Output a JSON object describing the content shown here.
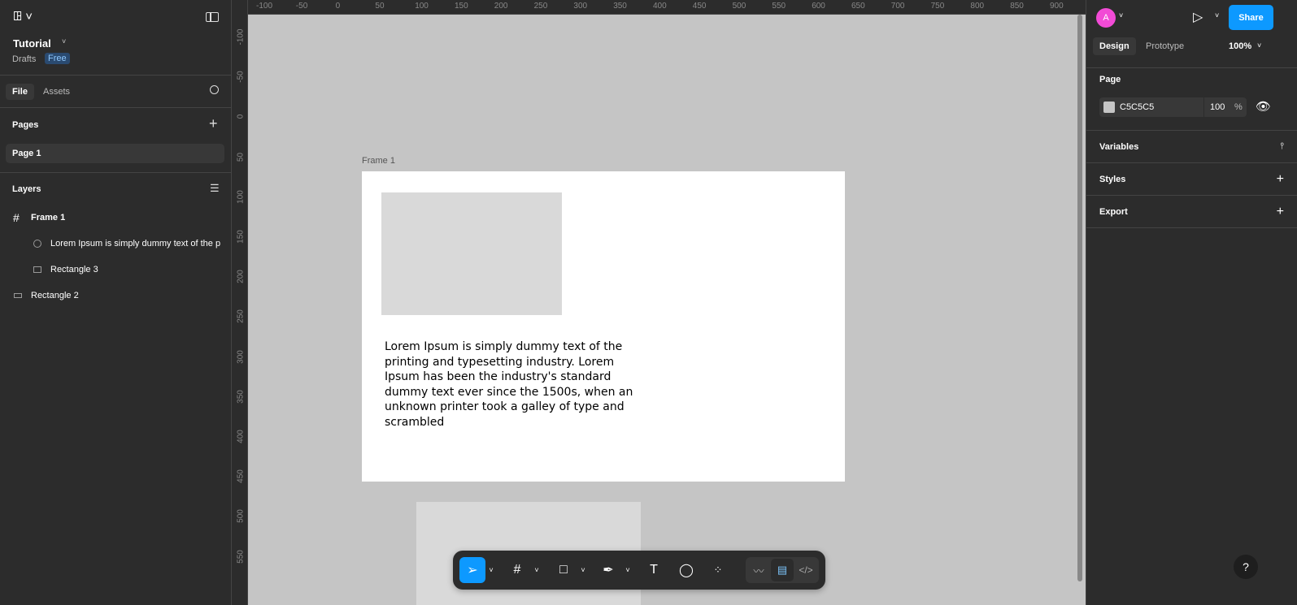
{
  "file": {
    "title": "Tutorial",
    "location": "Drafts",
    "plan_badge": "Free"
  },
  "left_tabs": [
    "File",
    "Assets"
  ],
  "pages": {
    "title": "Pages",
    "items": [
      "Page 1"
    ]
  },
  "layers": {
    "title": "Layers",
    "items": [
      {
        "name": "Frame 1",
        "type": "frame",
        "depth": 0
      },
      {
        "name": "Lorem Ipsum is simply dummy text of the p",
        "type": "ellipse",
        "depth": 1
      },
      {
        "name": "Rectangle 3",
        "type": "rectangle",
        "depth": 1
      },
      {
        "name": "Rectangle 2",
        "type": "rectangle",
        "depth": 0
      }
    ]
  },
  "ruler_top": [
    "-100",
    "-50",
    "0",
    "50",
    "100",
    "150",
    "200",
    "250",
    "300",
    "350",
    "400",
    "450",
    "500",
    "550",
    "600",
    "650",
    "700",
    "750",
    "800",
    "850",
    "900"
  ],
  "ruler_left": [
    "-100",
    "-50",
    "0",
    "50",
    "100",
    "150",
    "200",
    "250",
    "300",
    "350",
    "400",
    "450",
    "500",
    "550"
  ],
  "canvas": {
    "frame_label": "Frame 1",
    "text": "Lorem Ipsum is simply dummy text of the printing and typesetting industry. Lorem Ipsum has been the industry's standard dummy text ever since the 1500s, when an unknown printer took a galley of type and scrambled"
  },
  "right": {
    "avatar": "A",
    "share": "Share",
    "tabs": [
      "Design",
      "Prototype"
    ],
    "zoom": "100%",
    "page_title": "Page",
    "page_color": "C5C5C5",
    "page_opacity": "100",
    "percent": "%",
    "sections": [
      "Variables",
      "Styles",
      "Export"
    ]
  },
  "help": "?",
  "colors": {
    "accent": "#0d99ff",
    "avatar": "#f24bd6",
    "canvas": "#c5c5c5"
  }
}
